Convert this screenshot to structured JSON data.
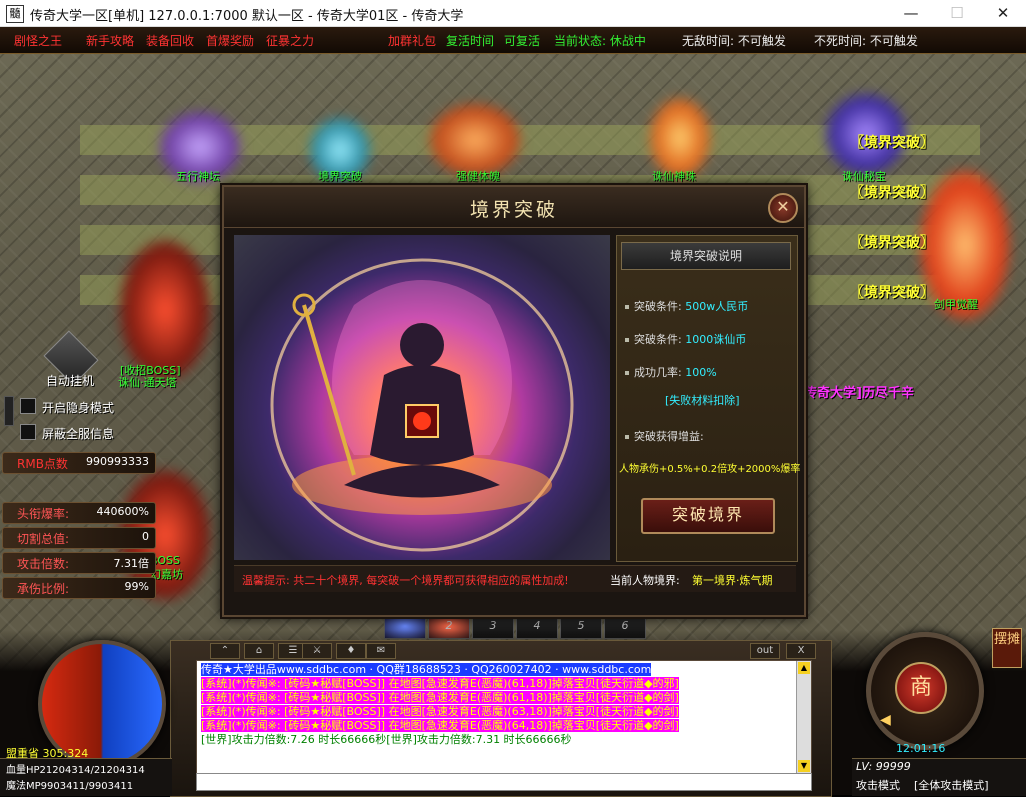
{
  "window": {
    "title": "传奇大学一区[单机] 127.0.0.1:7000  默认一区  - 传奇大学01区 - 传奇大学",
    "icon": "髓",
    "minimize": "—",
    "maximize": "☐",
    "close": "✕"
  },
  "topbar": {
    "menu": [
      "剧怪之王",
      "新手攻略",
      "装备回收",
      "首爆奖励",
      "征暴之力"
    ],
    "actions": [
      "加群礼包",
      "复活时间",
      "可复活",
      "当前状态: 休战中"
    ],
    "status": [
      "无敌时间: 不可触发",
      "不死时间: 不可触发"
    ]
  },
  "scene": {
    "npcs": [
      "五行神坛",
      "境界突破",
      "强健体魄",
      "诛仙神珠",
      "诛仙秘宝",
      "剑甲觉醒"
    ],
    "breakthrough_tags": [
      "〖境界突破〗",
      "〖境界突破〗",
      "〖境界突破〗",
      "〖境界突破〗"
    ],
    "marquee": "传奇大学]历尽千辛",
    "boss_label_1": "[收招BOSS]",
    "boss_label_2": "诛仙·通天塔",
    "boss_label_3": "BOSS",
    "boss_label_4": "幻嘉坊"
  },
  "left_panel": {
    "auto_hang": "自动挂机",
    "options": [
      "开启隐身模式",
      "屏蔽全服信息"
    ],
    "rmb_label": "RMB点数",
    "rmb_value": "990993333",
    "stats": [
      {
        "label": "头衔爆率:",
        "value": "440600%"
      },
      {
        "label": "切割总值:",
        "value": "0"
      },
      {
        "label": "攻击倍数:",
        "value": "7.31倍"
      },
      {
        "label": "承伤比例:",
        "value": "99%"
      }
    ]
  },
  "dialog": {
    "title": "境界突破",
    "close": "✕",
    "info_header": "境界突破说明",
    "conditions": [
      {
        "label": "突破条件: ",
        "value": "500w人民币"
      },
      {
        "label": "突破条件: ",
        "value": "1000诛仙币"
      },
      {
        "label": "成功几率: ",
        "value": "100%"
      }
    ],
    "fail_note": "[失败材料扣除]",
    "gain_label": "突破获得增益:",
    "gain_value": "人物承伤+0.5%+0.2倍攻+2000%爆率",
    "button": "突破境界",
    "tip": "温馨提示: 共二十个境界, 每突破一个境界都可获得相应的属性加成!",
    "current_realm_label": "当前人物境界: ",
    "current_realm": "第一境界·炼气期"
  },
  "hotbar": [
    "2",
    "3",
    "4",
    "5",
    "6"
  ],
  "chat": {
    "top_buttons": [
      "out",
      "X"
    ],
    "lines": [
      {
        "text": "传奇★大学出品www.sddbc.com · QQ群18688523 · QQ260027402 · www.sddbc.com",
        "color": "#ffffff",
        "bg": "#1a3cff"
      },
      {
        "text": "[系统](*)传闻※: [砖码★秘赋[BOSS]] 在地图[急速发育E(恶魔)(61,18)]掉落宝贝[徒天衍道◆的邪]",
        "color": "#ffff00",
        "bg": "#ff00ff"
      },
      {
        "text": "[系统](*)传闻※: [砖码★秘赋[BOSS]] 在地图[急速发育E(恶魔)(61,18)]掉落宝贝[徒天衍道◆的剑]",
        "color": "#ffff00",
        "bg": "#ff00ff"
      },
      {
        "text": "[系统](*)传闻※: [砖码★秘赋[BOSS]] 在地图[急速发育E(恶魔)(63,18)]掉落宝贝[徒天衍道◆的剑]",
        "color": "#ffff00",
        "bg": "#ff00ff"
      },
      {
        "text": "[系统](*)传闻※: [砖码★秘赋[BOSS]] 在地图[急速发育E(恶魔)(64,18)]掉落宝贝[徒天衍道◆的剑]",
        "color": "#ffff00",
        "bg": "#ff00ff"
      },
      {
        "text": "[世界]攻击力倍数:7.26 时长66666秒",
        "color": "#008000",
        "bg": "transparent"
      },
      {
        "text": "[世界]攻击力倍数:7.31 时长66666秒",
        "color": "#008000",
        "bg": "transparent"
      }
    ]
  },
  "player": {
    "location": "盟重省 305:324",
    "hp": "血量HP21204314/21204314",
    "mp": "魔法MP9903411/9903411"
  },
  "right_hud": {
    "shop": "商",
    "toggle": "摆摊",
    "time": "12:01:16",
    "lv": "LV: 99999",
    "mode_label": "攻击模式",
    "mode_value": "[全体攻击模式]"
  }
}
